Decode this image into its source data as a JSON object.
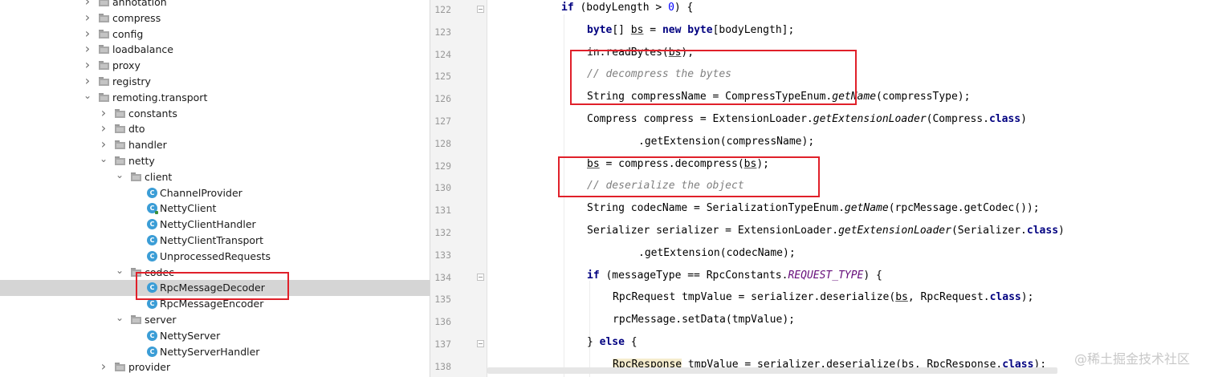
{
  "tree": {
    "items": [
      {
        "label": "annotation",
        "type": "folder",
        "expandable": true,
        "expanded": false,
        "depth": 0
      },
      {
        "label": "compress",
        "type": "folder",
        "expandable": true,
        "expanded": false,
        "depth": 0
      },
      {
        "label": "config",
        "type": "folder",
        "expandable": true,
        "expanded": false,
        "depth": 0
      },
      {
        "label": "loadbalance",
        "type": "folder",
        "expandable": true,
        "expanded": false,
        "depth": 0
      },
      {
        "label": "proxy",
        "type": "folder",
        "expandable": true,
        "expanded": false,
        "depth": 0
      },
      {
        "label": "registry",
        "type": "folder",
        "expandable": true,
        "expanded": false,
        "depth": 0
      },
      {
        "label": "remoting.transport",
        "type": "folder",
        "expandable": true,
        "expanded": true,
        "depth": 0
      },
      {
        "label": "constants",
        "type": "folder",
        "expandable": true,
        "expanded": false,
        "depth": 1
      },
      {
        "label": "dto",
        "type": "folder",
        "expandable": true,
        "expanded": false,
        "depth": 1
      },
      {
        "label": "handler",
        "type": "folder",
        "expandable": true,
        "expanded": false,
        "depth": 1
      },
      {
        "label": "netty",
        "type": "folder",
        "expandable": true,
        "expanded": true,
        "depth": 1
      },
      {
        "label": "client",
        "type": "folder",
        "expandable": true,
        "expanded": true,
        "depth": 2
      },
      {
        "label": "ChannelProvider",
        "type": "class",
        "expandable": false,
        "depth": 3
      },
      {
        "label": "NettyClient",
        "type": "class",
        "expandable": false,
        "depth": 3,
        "pinned": true
      },
      {
        "label": "NettyClientHandler",
        "type": "class",
        "expandable": false,
        "depth": 3
      },
      {
        "label": "NettyClientTransport",
        "type": "class",
        "expandable": false,
        "depth": 3
      },
      {
        "label": "UnprocessedRequests",
        "type": "class",
        "expandable": false,
        "depth": 3
      },
      {
        "label": "codec",
        "type": "folder",
        "expandable": true,
        "expanded": true,
        "depth": 2
      },
      {
        "label": "RpcMessageDecoder",
        "type": "class",
        "expandable": false,
        "depth": 3,
        "selected": true
      },
      {
        "label": "RpcMessageEncoder",
        "type": "class",
        "expandable": false,
        "depth": 3
      },
      {
        "label": "server",
        "type": "folder",
        "expandable": true,
        "expanded": true,
        "depth": 2
      },
      {
        "label": "NettyServer",
        "type": "class",
        "expandable": false,
        "depth": 3
      },
      {
        "label": "NettyServerHandler",
        "type": "class",
        "expandable": false,
        "depth": 3
      },
      {
        "label": "provider",
        "type": "folder",
        "expandable": true,
        "expanded": false,
        "depth": 1
      }
    ]
  },
  "editor": {
    "lines": [
      {
        "n": "122",
        "fold": true,
        "tokens": [
          {
            "t": "if",
            "c": "kw"
          },
          {
            "t": " (bodyLength > "
          },
          {
            "t": "0",
            "c": "num"
          },
          {
            "t": ") {"
          }
        ]
      },
      {
        "n": "123",
        "fold": false,
        "tokens": [
          {
            "t": "byte",
            "c": "kw"
          },
          {
            "t": "[] "
          },
          {
            "t": "bs",
            "c": "ul"
          },
          {
            "t": " = "
          },
          {
            "t": "new",
            "c": "kw"
          },
          {
            "t": " "
          },
          {
            "t": "byte",
            "c": "kw"
          },
          {
            "t": "[bodyLength];"
          }
        ]
      },
      {
        "n": "124",
        "fold": false,
        "tokens": [
          {
            "t": "in.readBytes("
          },
          {
            "t": "bs",
            "c": "ul"
          },
          {
            "t": ");"
          }
        ]
      },
      {
        "n": "125",
        "fold": false,
        "tokens": [
          {
            "t": "// decompress the bytes",
            "c": "cmt"
          }
        ]
      },
      {
        "n": "126",
        "fold": false,
        "tokens": [
          {
            "t": "String compressName = CompressTypeEnum."
          },
          {
            "t": "getName",
            "c": "sm"
          },
          {
            "t": "(compressType);"
          }
        ]
      },
      {
        "n": "127",
        "fold": false,
        "tokens": [
          {
            "t": "Compress compress = ExtensionLoader."
          },
          {
            "t": "getExtensionLoader",
            "c": "sm"
          },
          {
            "t": "(Compress."
          },
          {
            "t": "class",
            "c": "kw"
          },
          {
            "t": ")"
          }
        ]
      },
      {
        "n": "128",
        "fold": false,
        "tokens": [
          {
            "t": ".getExtension(compressName);"
          }
        ]
      },
      {
        "n": "129",
        "fold": false,
        "tokens": [
          {
            "t": "bs",
            "c": "ul"
          },
          {
            "t": " = compress.decompress("
          },
          {
            "t": "bs",
            "c": "ul"
          },
          {
            "t": ");"
          }
        ]
      },
      {
        "n": "130",
        "fold": false,
        "tokens": [
          {
            "t": "// deserialize the object",
            "c": "cmt"
          }
        ]
      },
      {
        "n": "131",
        "fold": false,
        "tokens": [
          {
            "t": "String codecName = SerializationTypeEnum."
          },
          {
            "t": "getName",
            "c": "sm"
          },
          {
            "t": "(rpcMessage.getCodec());"
          }
        ]
      },
      {
        "n": "132",
        "fold": false,
        "tokens": [
          {
            "t": "Serializer serializer = ExtensionLoader."
          },
          {
            "t": "getExtensionLoader",
            "c": "sm"
          },
          {
            "t": "(Serializer."
          },
          {
            "t": "class",
            "c": "kw"
          },
          {
            "t": ")"
          }
        ]
      },
      {
        "n": "133",
        "fold": false,
        "tokens": [
          {
            "t": ".getExtension(codecName);"
          }
        ]
      },
      {
        "n": "134",
        "fold": true,
        "tokens": [
          {
            "t": "if",
            "c": "kw"
          },
          {
            "t": " (messageType == RpcConstants."
          },
          {
            "t": "REQUEST_TYPE",
            "c": "cst"
          },
          {
            "t": ") {"
          }
        ]
      },
      {
        "n": "135",
        "fold": false,
        "tokens": [
          {
            "t": "RpcRequest tmpValue = serializer.deserialize("
          },
          {
            "t": "bs",
            "c": "ul"
          },
          {
            "t": ", RpcRequest."
          },
          {
            "t": "class",
            "c": "kw"
          },
          {
            "t": ");"
          }
        ]
      },
      {
        "n": "136",
        "fold": false,
        "tokens": [
          {
            "t": "rpcMessage.setData(tmpValue);"
          }
        ]
      },
      {
        "n": "137",
        "fold": true,
        "tokens": [
          {
            "t": "} "
          },
          {
            "t": "else",
            "c": "kw"
          },
          {
            "t": " {"
          }
        ]
      },
      {
        "n": "138",
        "fold": false,
        "tokens": [
          {
            "t": "RpcResponse",
            "c": "hlw"
          },
          {
            "t": " tmpValue = serializer.deserialize("
          },
          {
            "t": "bs",
            "c": "ul"
          },
          {
            "t": ", RpcResponse."
          },
          {
            "t": "class",
            "c": "kw"
          },
          {
            "t": ");"
          }
        ]
      }
    ]
  },
  "watermark": "@稀土掘金技术社区",
  "colors": {
    "annotation_box": "#e0202a",
    "selection": "#d5d5d5",
    "keyword": "#000080",
    "number": "#0000ff",
    "comment": "#808080",
    "constant": "#660e7a",
    "class_icon": "#3b9dd6"
  }
}
